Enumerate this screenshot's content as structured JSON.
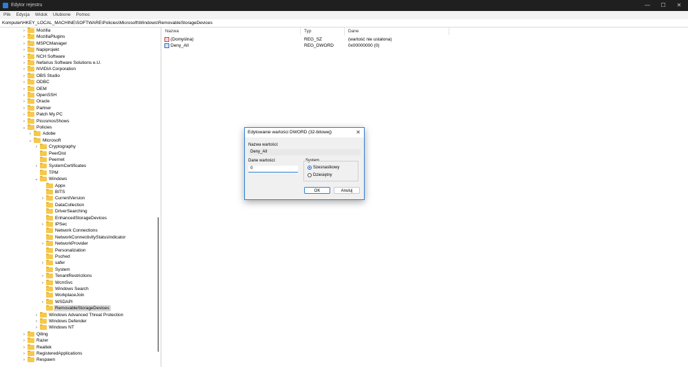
{
  "window": {
    "title": "Edytor rejestru",
    "minimize_glyph": "—",
    "maximize_glyph": "☐",
    "close_glyph": "✕",
    "accent_color": "#2a7fd4"
  },
  "menu": [
    "Plik",
    "Edycja",
    "Widok",
    "Ulubione",
    "Pomoc"
  ],
  "address": "Komputer\\HKEY_LOCAL_MACHINE\\SOFTWARE\\Policies\\Microsoft\\Windows\\RemovableStorageDevices",
  "tree": [
    {
      "label": "Mozilla",
      "level": 0,
      "state": "collapsed"
    },
    {
      "label": "MozillaPlugins",
      "level": 0,
      "state": "collapsed"
    },
    {
      "label": "MSPCManager",
      "level": 0,
      "state": "collapsed"
    },
    {
      "label": "Napiprojekt",
      "level": 0,
      "state": "collapsed"
    },
    {
      "label": "NCH Software",
      "level": 0,
      "state": "collapsed"
    },
    {
      "label": "Nefarius Software Solutions e.U.",
      "level": 0,
      "state": "collapsed"
    },
    {
      "label": "NVIDIA Corporation",
      "level": 0,
      "state": "collapsed"
    },
    {
      "label": "OBS Studio",
      "level": 0,
      "state": "collapsed"
    },
    {
      "label": "ODBC",
      "level": 0,
      "state": "collapsed"
    },
    {
      "label": "OEM",
      "level": 0,
      "state": "collapsed"
    },
    {
      "label": "OpenSSH",
      "level": 0,
      "state": "collapsed"
    },
    {
      "label": "Oracle",
      "level": 0,
      "state": "collapsed"
    },
    {
      "label": "Partner",
      "level": 0,
      "state": "collapsed"
    },
    {
      "label": "Patch My PC",
      "level": 0,
      "state": "collapsed"
    },
    {
      "label": "PicosmosShows",
      "level": 0,
      "state": "collapsed"
    },
    {
      "label": "Policies",
      "level": 0,
      "state": "expanded"
    },
    {
      "label": "Adobe",
      "level": 1,
      "state": "collapsed"
    },
    {
      "label": "Microsoft",
      "level": 1,
      "state": "expanded"
    },
    {
      "label": "Cryptography",
      "level": 2,
      "state": "collapsed"
    },
    {
      "label": "PeerDist",
      "level": 2,
      "state": "none"
    },
    {
      "label": "Peernet",
      "level": 2,
      "state": "none"
    },
    {
      "label": "SystemCertificates",
      "level": 2,
      "state": "collapsed"
    },
    {
      "label": "TPM",
      "level": 2,
      "state": "none"
    },
    {
      "label": "Windows",
      "level": 2,
      "state": "expanded"
    },
    {
      "label": "Appx",
      "level": 3,
      "state": "none"
    },
    {
      "label": "BITS",
      "level": 3,
      "state": "none"
    },
    {
      "label": "CurrentVersion",
      "level": 3,
      "state": "collapsed"
    },
    {
      "label": "DataCollection",
      "level": 3,
      "state": "none"
    },
    {
      "label": "DriverSearching",
      "level": 3,
      "state": "none"
    },
    {
      "label": "EnhancedStorageDevices",
      "level": 3,
      "state": "none"
    },
    {
      "label": "IPSec",
      "level": 3,
      "state": "collapsed"
    },
    {
      "label": "Network Connections",
      "level": 3,
      "state": "none"
    },
    {
      "label": "NetworkConnectivityStatusIndicator",
      "level": 3,
      "state": "none"
    },
    {
      "label": "NetworkProvider",
      "level": 3,
      "state": "collapsed"
    },
    {
      "label": "Personalization",
      "level": 3,
      "state": "none"
    },
    {
      "label": "Psched",
      "level": 3,
      "state": "none"
    },
    {
      "label": "safer",
      "level": 3,
      "state": "collapsed"
    },
    {
      "label": "System",
      "level": 3,
      "state": "none"
    },
    {
      "label": "TenantRestrictions",
      "level": 3,
      "state": "collapsed"
    },
    {
      "label": "WcmSvc",
      "level": 3,
      "state": "collapsed"
    },
    {
      "label": "Windows Search",
      "level": 3,
      "state": "none"
    },
    {
      "label": "WorkplaceJoin",
      "level": 3,
      "state": "none"
    },
    {
      "label": "WSDAPI",
      "level": 3,
      "state": "collapsed"
    },
    {
      "label": "RemovableStorageDevices",
      "level": 3,
      "state": "none",
      "selected": true
    },
    {
      "label": "Windows Advanced Threat Protection",
      "level": 2,
      "state": "collapsed"
    },
    {
      "label": "Windows Defender",
      "level": 2,
      "state": "collapsed"
    },
    {
      "label": "Windows NT",
      "level": 2,
      "state": "collapsed"
    },
    {
      "label": "Qiling",
      "level": 0,
      "state": "collapsed"
    },
    {
      "label": "Razer",
      "level": 0,
      "state": "collapsed"
    },
    {
      "label": "Realtek",
      "level": 0,
      "state": "collapsed"
    },
    {
      "label": "RegisteredApplications",
      "level": 0,
      "state": "collapsed"
    },
    {
      "label": "Respawn",
      "level": 0,
      "state": "collapsed"
    }
  ],
  "list": {
    "headers": {
      "name": "Nazwa",
      "type": "Typ",
      "data": "Dane"
    },
    "rows": [
      {
        "name": "(Domyślna)",
        "type": "REG_SZ",
        "data": "(wartość nie ustalona)",
        "icon": "string-value-icon"
      },
      {
        "name": "Deny_All",
        "type": "REG_DWORD",
        "data": "0x00000000 (0)",
        "icon": "dword-value-icon"
      }
    ]
  },
  "dialog": {
    "title": "Edytowanie wartości DWORD (32-bitowej)",
    "close_glyph": "✕",
    "name_label": "Nazwa wartości:",
    "name_value": "Deny_All",
    "data_label": "Dane wartości:",
    "data_value": "0",
    "base_label": "System",
    "hex_label": "Szesnastkowy",
    "dec_label": "Dziesiętny",
    "selected_base": "hex",
    "ok_label": "OK",
    "cancel_label": "Anuluj"
  }
}
